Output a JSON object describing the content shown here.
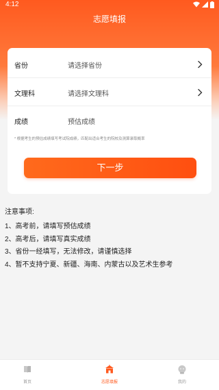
{
  "status_bar": {
    "time": "4:12"
  },
  "header": {
    "title": "志愿填报"
  },
  "form": {
    "rows": [
      {
        "label": "省份",
        "value": "请选择省份"
      },
      {
        "label": "文理科",
        "value": "请选择文理科"
      },
      {
        "label": "成绩",
        "value": "预估成绩"
      }
    ],
    "hint": "* 根据考生的预估成绩填写考试院成绩，匹配出适合考生的院校及测算录取概率",
    "next_button": "下一步"
  },
  "notes": {
    "title": "注意事项:",
    "items": [
      "1、高考前，请填写预估成绩",
      "2、高考后，请填写真实成绩",
      "3、省份一经填写，无法修改，请谨慎选择",
      "4、暂不支持宁夏、新疆、海南、内蒙古以及艺术生参考"
    ]
  },
  "tabbar": {
    "tabs": [
      {
        "label": "首页",
        "icon": "book-icon"
      },
      {
        "label": "志愿填报",
        "icon": "school-icon"
      },
      {
        "label": "我的",
        "icon": "user-icon"
      }
    ]
  },
  "colors": {
    "accent": "#ff5a1f",
    "background": "#f4f4f4",
    "card": "#ffffff"
  }
}
